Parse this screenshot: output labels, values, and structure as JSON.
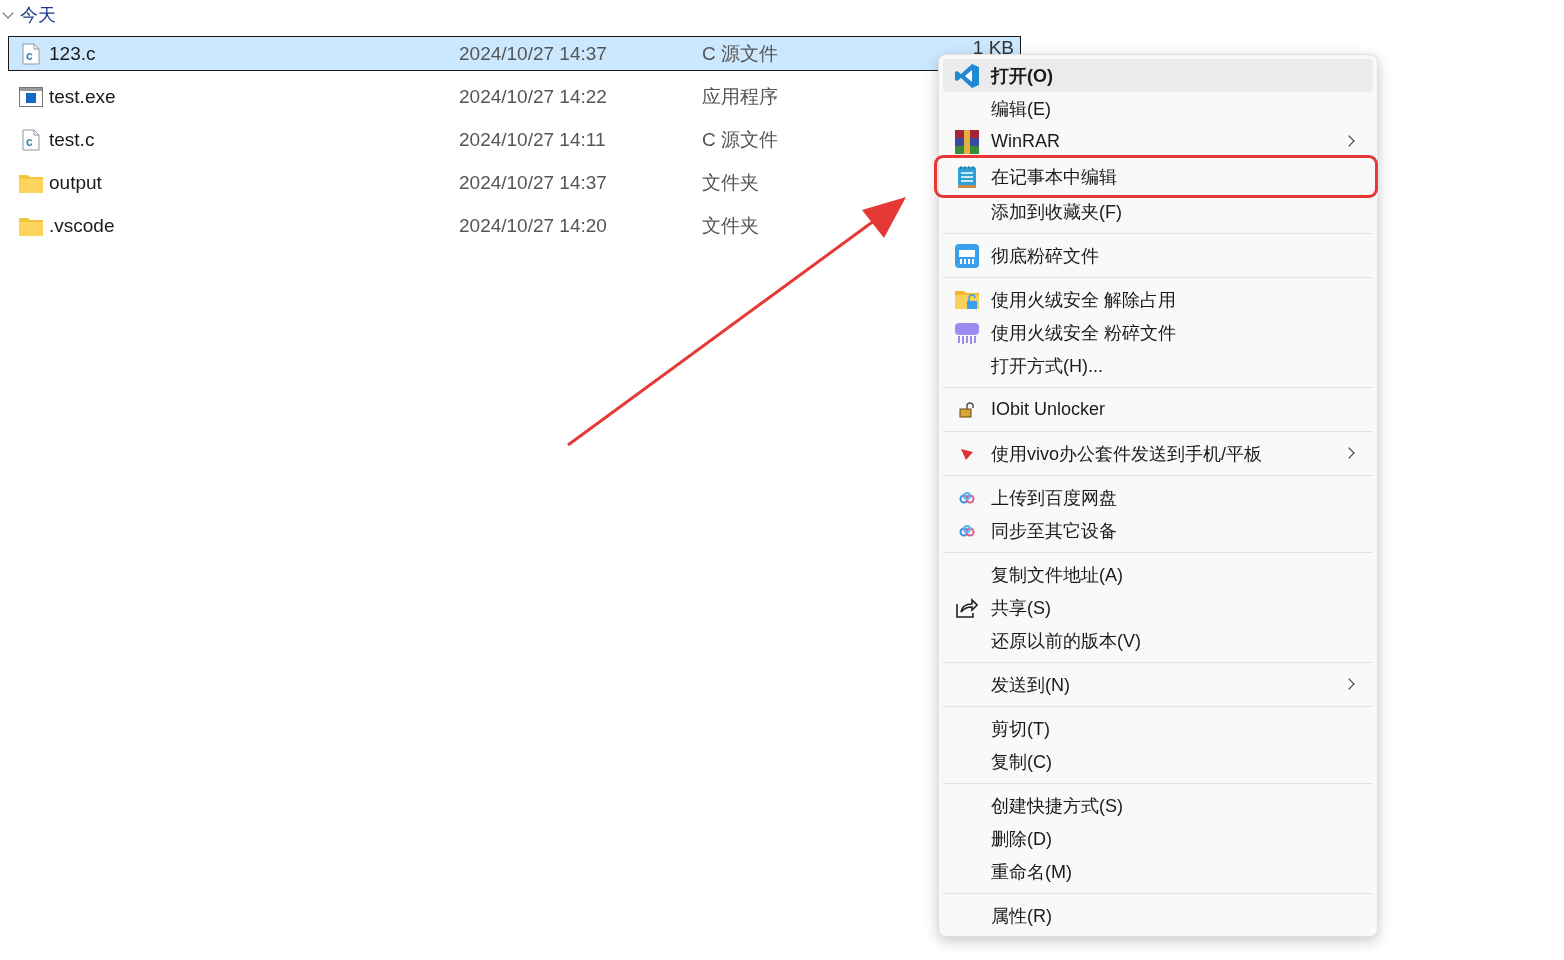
{
  "group": {
    "label": "今天",
    "expanded": true
  },
  "files": [
    {
      "name": "123.c",
      "date": "2024/10/27 14:37",
      "type": "C 源文件",
      "size": "1 KB",
      "kind": "c",
      "selected": true
    },
    {
      "name": "test.exe",
      "date": "2024/10/27 14:22",
      "type": "应用程序",
      "kind": "exe",
      "selected": false
    },
    {
      "name": "test.c",
      "date": "2024/10/27 14:11",
      "type": "C 源文件",
      "kind": "c",
      "selected": false
    },
    {
      "name": "output",
      "date": "2024/10/27 14:37",
      "type": "文件夹",
      "kind": "folder",
      "selected": false
    },
    {
      "name": ".vscode",
      "date": "2024/10/27 14:20",
      "type": "文件夹",
      "kind": "folder",
      "selected": false
    }
  ],
  "context_menu": {
    "groups": [
      [
        {
          "label": "打开(O)",
          "kind": "vscode",
          "default": true,
          "selected": true
        },
        {
          "label": "编辑(E)",
          "selected": false
        },
        {
          "label": "WinRAR",
          "kind": "winrar",
          "submenu": true,
          "selected": false
        },
        {
          "label": "在记事本中编辑",
          "kind": "notepad",
          "highlighted_box": true,
          "selected": false
        },
        {
          "label": "添加到收藏夹(F)",
          "selected": false
        }
      ],
      [
        {
          "label": "彻底粉碎文件",
          "kind": "shredder",
          "selected": false
        }
      ],
      [
        {
          "label": "使用火绒安全 解除占用",
          "kind": "folderlock",
          "selected": false
        },
        {
          "label": "使用火绒安全 粉碎文件",
          "kind": "shredder2",
          "selected": false
        },
        {
          "label": "打开方式(H)...",
          "selected": false
        }
      ],
      [
        {
          "label": "IObit Unlocker",
          "kind": "padlock",
          "selected": false
        }
      ],
      [
        {
          "label": "使用vivo办公套件发送到手机/平板",
          "kind": "vivo",
          "submenu": true,
          "selected": false
        }
      ],
      [
        {
          "label": "上传到百度网盘",
          "kind": "cloud",
          "selected": false
        },
        {
          "label": "同步至其它设备",
          "kind": "cloud",
          "selected": false
        }
      ],
      [
        {
          "label": "复制文件地址(A)",
          "selected": false
        },
        {
          "label": "共享(S)",
          "kind": "share",
          "selected": false
        },
        {
          "label": "还原以前的版本(V)",
          "selected": false
        }
      ],
      [
        {
          "label": "发送到(N)",
          "submenu": true,
          "selected": false
        }
      ],
      [
        {
          "label": "剪切(T)",
          "selected": false
        },
        {
          "label": "复制(C)",
          "selected": false
        }
      ],
      [
        {
          "label": "创建快捷方式(S)",
          "selected": false
        },
        {
          "label": "删除(D)",
          "selected": false
        },
        {
          "label": "重命名(M)",
          "selected": false
        }
      ],
      [
        {
          "label": "属性(R)",
          "selected": false
        }
      ]
    ]
  }
}
